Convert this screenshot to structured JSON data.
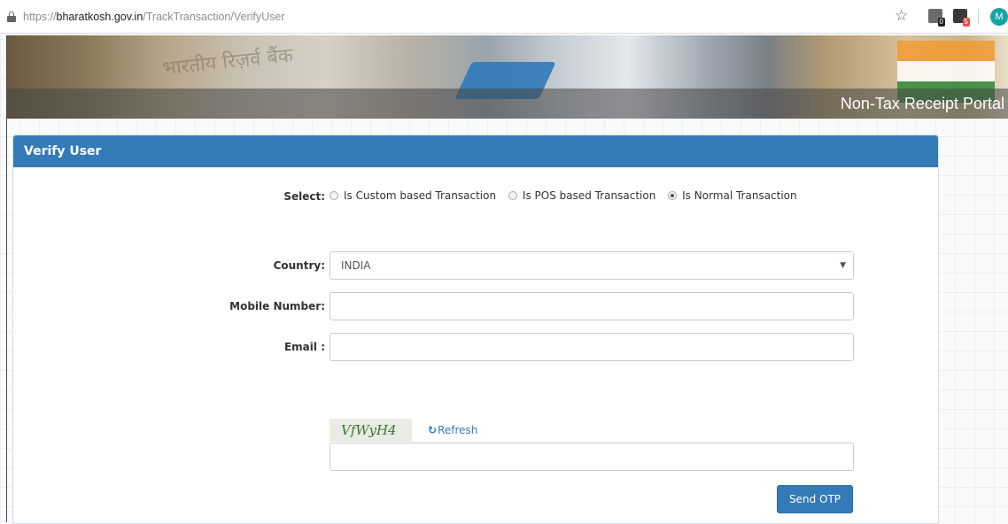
{
  "browser": {
    "url_scheme": "https://",
    "url_host": "bharatkosh.gov.in",
    "url_path": "/TrackTransaction/VerifyUser",
    "star_icon": "☆",
    "ext1_badge": "0",
    "ext2_badge": "5",
    "avatar_letter": "M"
  },
  "banner": {
    "title": "Non-Tax Receipt Portal",
    "note_text": "भारतीय रिज़र्व बैंक"
  },
  "panel": {
    "title": "Verify User"
  },
  "form": {
    "select_label": "Select:",
    "options": [
      {
        "label": "Is Custom based Transaction",
        "checked": false
      },
      {
        "label": "Is POS based Transaction",
        "checked": false
      },
      {
        "label": "Is Normal Transaction",
        "checked": true
      }
    ],
    "country_label": "Country:",
    "country_value": "INDIA",
    "caret": "▼",
    "mobile_label": "Mobile Number:",
    "mobile_value": "",
    "email_label": "Email :",
    "email_value": "",
    "captcha_text": "VfWyH4",
    "refresh_icon": "↻",
    "refresh_label": "Refresh",
    "captcha_input_value": "",
    "send_otp_label": "Send OTP"
  },
  "colors": {
    "primary": "#337ab7",
    "captcha_text": "#3a7a2a"
  }
}
